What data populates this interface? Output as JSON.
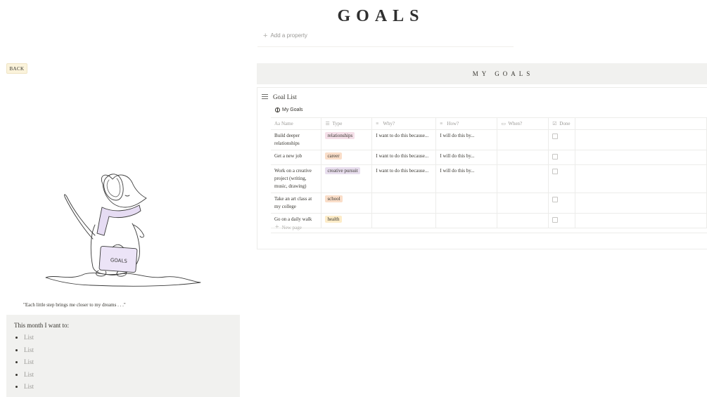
{
  "page": {
    "title": "GOALS",
    "add_property": "Add a property"
  },
  "back_button": "BACK",
  "right_panel": {
    "header": "MY GOALS",
    "database_title": "Goal List",
    "view_name": "My Goals",
    "columns": [
      {
        "label": "Name",
        "icon": "text-icon"
      },
      {
        "label": "Type",
        "icon": "list-icon"
      },
      {
        "label": "Why?",
        "icon": "lines-icon"
      },
      {
        "label": "How?",
        "icon": "lines-icon"
      },
      {
        "label": "When?",
        "icon": "calendar-icon"
      },
      {
        "label": "Done",
        "icon": "checkbox-icon"
      }
    ],
    "rows": [
      {
        "name": "Build deeper relationships",
        "type": "relationships",
        "why": "I want to do this because...",
        "how": "I will do this by...",
        "when": "",
        "done": false
      },
      {
        "name": "Get a new job",
        "type": "career",
        "why": "I want to do this because...",
        "how": "I will do this by...",
        "when": "",
        "done": false
      },
      {
        "name": "Work on a creative project (writing, music, drawing)",
        "type": "creative pursuit",
        "why": "I want to do this because...",
        "how": "I will do this by...",
        "when": "",
        "done": false
      },
      {
        "name": "Take an art class at my college",
        "type": "school",
        "why": "",
        "how": "",
        "when": "",
        "done": false
      },
      {
        "name": "Go on a daily walk",
        "type": "health",
        "why": "",
        "how": "",
        "when": "",
        "done": false
      }
    ],
    "tag_colors": {
      "relationships": "#f5e0e9",
      "career": "#fadec9",
      "creative pursuit": "#e8deee",
      "school": "#fadec9",
      "health": "#fdecc8"
    },
    "new_page": "New page"
  },
  "illustration": {
    "suitcase_text": "GOALS"
  },
  "quote": "\"Each little step brings me closer to my dreams . . .\"",
  "month_box": {
    "title": "This month I want to:",
    "items": [
      "List",
      "List",
      "List",
      "List",
      "List"
    ]
  }
}
